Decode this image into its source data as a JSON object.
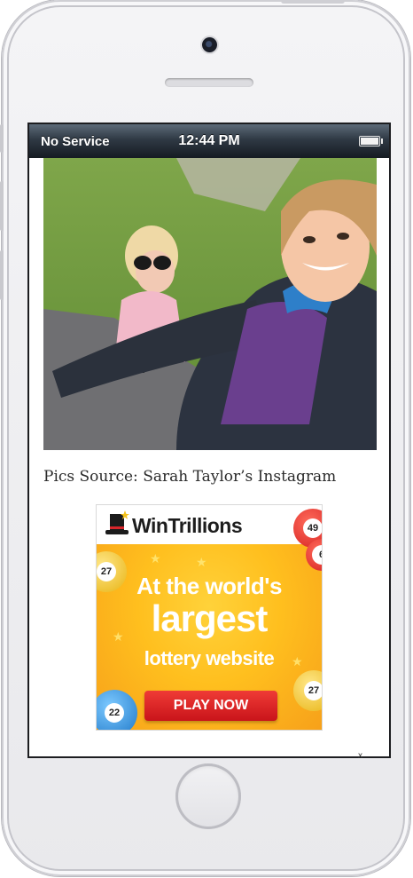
{
  "status_bar": {
    "carrier": "No Service",
    "time": "12:44 PM"
  },
  "article": {
    "photo_alt": "Selfie of a woman with a child in sunglasses",
    "caption": "Pics Source: Sarah Taylor’s Instagram"
  },
  "ad": {
    "brand": "WinTrillions",
    "line1": "At the world's",
    "line2": "largest",
    "line3": "lottery website",
    "cta": "PLAY NOW",
    "balls": [
      "49",
      "6",
      "27",
      "22",
      "27"
    ]
  },
  "close_symbol": "x",
  "colors": {
    "ad_yellow": "#ffbf1e",
    "cta_red": "#d81e22",
    "status_bar": "#1f2730"
  }
}
